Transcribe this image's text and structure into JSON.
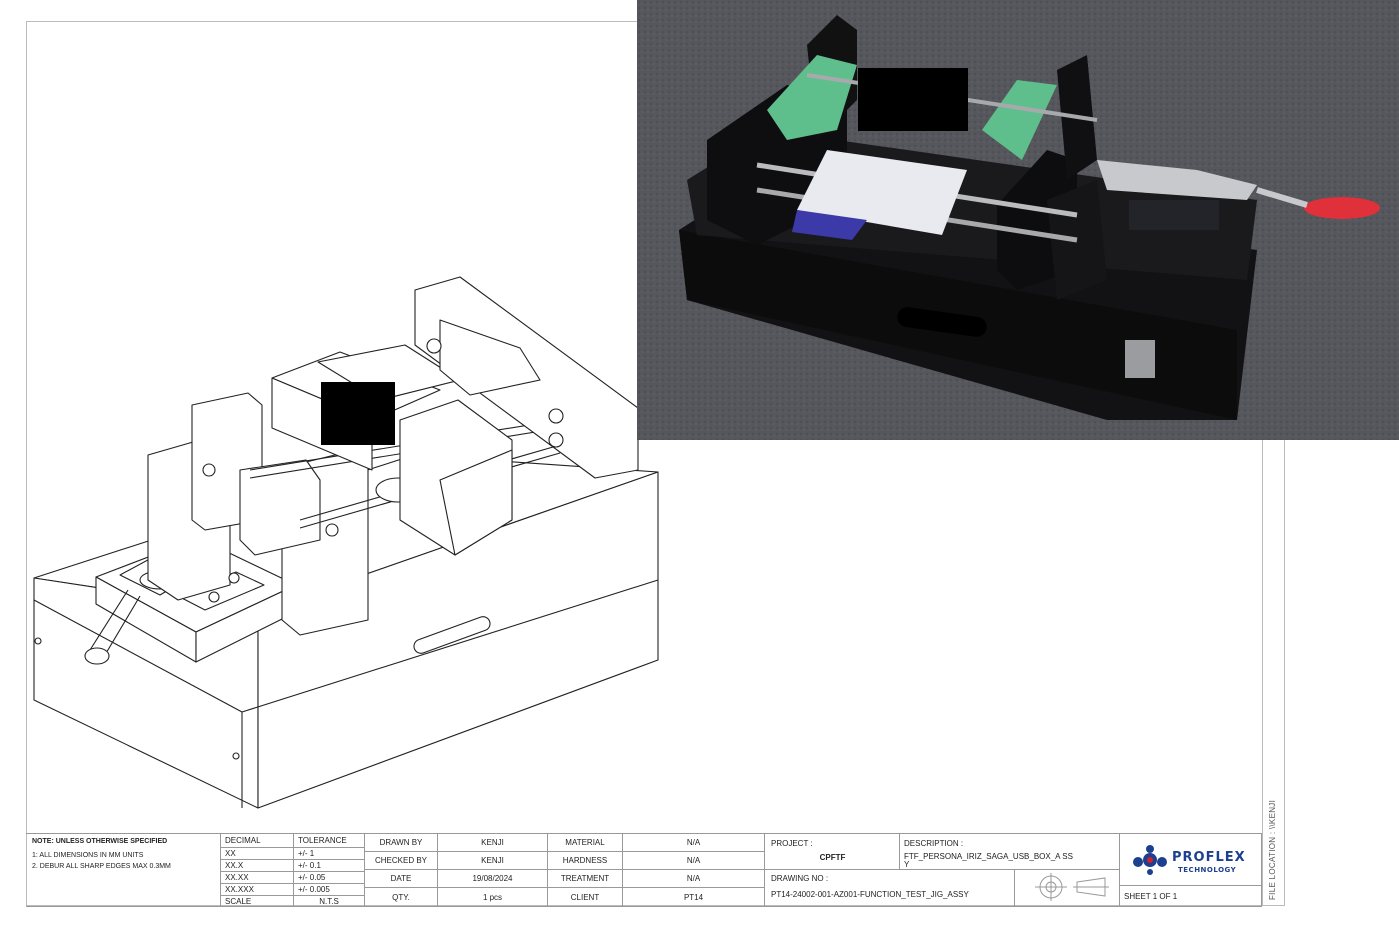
{
  "notes": {
    "title": "NOTE: UNLESS OTHERWISE SPECIFIED",
    "items": [
      "1: ALL DIMENSIONS IN MM UNITS",
      "2. DEBUR ALL SHARP EDGES MAX 0.3MM"
    ]
  },
  "tolerances": {
    "decimal_header": "DECIMAL",
    "tolerance_header": "TOLERANCE",
    "rows": [
      {
        "decimal": "XX",
        "tolerance": "+/- 1"
      },
      {
        "decimal": "XX.X",
        "tolerance": "+/- 0.1"
      },
      {
        "decimal": "XX.XX",
        "tolerance": "+/- 0.05"
      },
      {
        "decimal": "XX.XXX",
        "tolerance": "+/- 0.005"
      }
    ],
    "scale_label": "SCALE",
    "scale_value": "N.T.S"
  },
  "info": {
    "drawn_by_label": "DRAWN BY",
    "drawn_by": "KENJI",
    "checked_by_label": "CHECKED BY",
    "checked_by": "KENJI",
    "date_label": "DATE",
    "date": "19/08/2024",
    "qty_label": "QTY.",
    "qty": "1 pcs",
    "material_label": "MATERIAL",
    "material": "N/A",
    "hardness_label": "HARDNESS",
    "hardness": "N/A",
    "treatment_label": "TREATMENT",
    "treatment": "N/A",
    "client_label": "CLIENT",
    "client": "PT14"
  },
  "project": {
    "project_label": "PROJECT :",
    "project": "CPFTF",
    "description_label": "DESCRIPTION :",
    "description": "FTF_PERSONA_IRIZ_SAGA_USB_BOX_A SSY",
    "drawing_no_label": "DRAWING NO :",
    "drawing_no": "PT14-24002-001-AZ001-FUNCTION_TEST_JIG_ASSY"
  },
  "company": {
    "name": "PROFLEX",
    "tagline": "TECHNOLOGY",
    "sheet": "SHEET 1 OF 1"
  },
  "file_location": "FILE LOCATION : \\\\KENJI",
  "colors": {
    "brand_blue": "#1c3f8f",
    "logo_red": "#d4202a",
    "photo_bg": "#55575d",
    "green_pcb": "#5fbf8c",
    "clamp_red": "#e0303a"
  }
}
